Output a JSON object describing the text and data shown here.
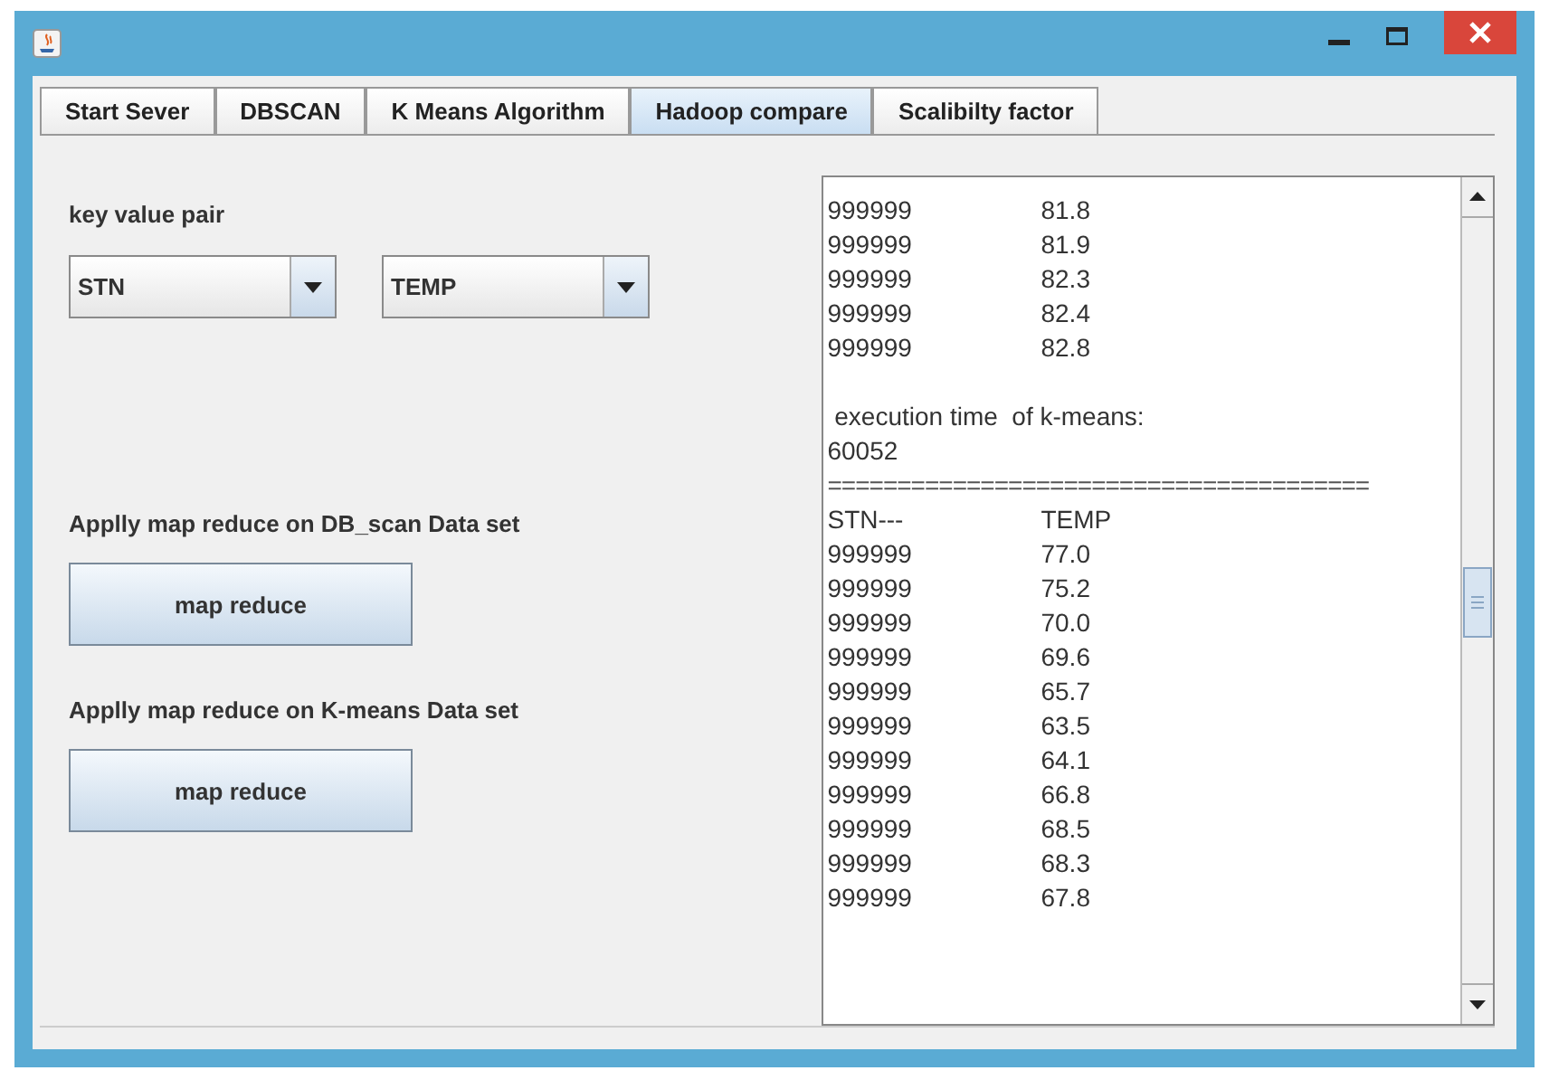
{
  "tabs": [
    {
      "label": "Start Sever",
      "selected": false
    },
    {
      "label": "DBSCAN",
      "selected": false
    },
    {
      "label": "K Means Algorithm",
      "selected": false
    },
    {
      "label": "Hadoop compare",
      "selected": true
    },
    {
      "label": "Scalibilty factor",
      "selected": false
    }
  ],
  "key_value_label": "key value pair",
  "dropdowns": [
    {
      "value": "STN"
    },
    {
      "value": "TEMP"
    }
  ],
  "sections": [
    {
      "label": "Applly map reduce on DB_scan Data set",
      "button": "map reduce"
    },
    {
      "label": "Applly map reduce on K-means Data set",
      "button": "map reduce"
    }
  ],
  "output_lines": [
    {
      "kind": "row",
      "col_1": "999999",
      "col_2": "81.8"
    },
    {
      "kind": "row",
      "col_1": "999999",
      "col_2": "81.9"
    },
    {
      "kind": "row",
      "col_1": "999999",
      "col_2": "82.3"
    },
    {
      "kind": "row",
      "col_1": "999999",
      "col_2": "82.4"
    },
    {
      "kind": "row",
      "col_1": "999999",
      "col_2": "82.8"
    },
    {
      "kind": "blank"
    },
    {
      "kind": "text",
      "text": " execution time  of k-means:"
    },
    {
      "kind": "text",
      "text": "60052"
    },
    {
      "kind": "rule",
      "text": "======================================="
    },
    {
      "kind": "row",
      "col_1": "STN---",
      "col_2": "TEMP"
    },
    {
      "kind": "row",
      "col_1": "999999",
      "col_2": "77.0"
    },
    {
      "kind": "row",
      "col_1": "999999",
      "col_2": "75.2"
    },
    {
      "kind": "row",
      "col_1": "999999",
      "col_2": "70.0"
    },
    {
      "kind": "row",
      "col_1": "999999",
      "col_2": "69.6"
    },
    {
      "kind": "row",
      "col_1": "999999",
      "col_2": "65.7"
    },
    {
      "kind": "row",
      "col_1": "999999",
      "col_2": "63.5"
    },
    {
      "kind": "row",
      "col_1": "999999",
      "col_2": "64.1"
    },
    {
      "kind": "row",
      "col_1": "999999",
      "col_2": "66.8"
    },
    {
      "kind": "row",
      "col_1": "999999",
      "col_2": "68.5"
    },
    {
      "kind": "row",
      "col_1": "999999",
      "col_2": "68.3"
    },
    {
      "kind": "row",
      "col_1": "999999",
      "col_2": "67.8"
    }
  ]
}
